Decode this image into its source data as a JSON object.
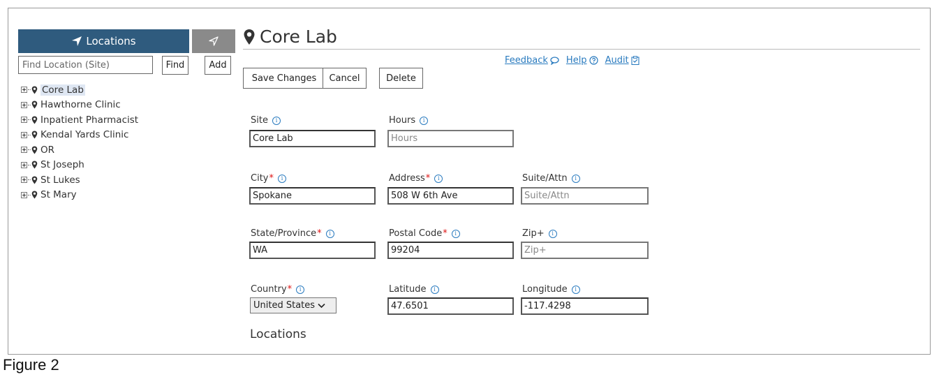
{
  "sidebar": {
    "tab_label": "Locations",
    "search_placeholder": "Find Location (Site)",
    "find_label": "Find",
    "add_label": "Add",
    "items": [
      {
        "label": "Core Lab"
      },
      {
        "label": "Hawthorne Clinic"
      },
      {
        "label": "Inpatient Pharmacist"
      },
      {
        "label": "Kendal Yards Clinic"
      },
      {
        "label": "OR"
      },
      {
        "label": "St Joseph"
      },
      {
        "label": "St Lukes"
      },
      {
        "label": "St Mary"
      }
    ]
  },
  "header": {
    "title": "Core Lab",
    "links": {
      "feedback": "Feedback",
      "help": "Help",
      "audit": "Audit"
    }
  },
  "toolbar": {
    "save_label": "Save Changes",
    "cancel_label": "Cancel",
    "delete_label": "Delete"
  },
  "form": {
    "site": {
      "label": "Site",
      "value": "Core Lab"
    },
    "hours": {
      "label": "Hours",
      "placeholder": "Hours"
    },
    "city": {
      "label": "City",
      "value": "Spokane"
    },
    "address": {
      "label": "Address",
      "value": "508 W 6th Ave"
    },
    "suite": {
      "label": "Suite/Attn",
      "placeholder": "Suite/Attn"
    },
    "state": {
      "label": "State/Province",
      "value": "WA"
    },
    "postal": {
      "label": "Postal Code",
      "value": "99204"
    },
    "zip_plus": {
      "label": "Zip+",
      "placeholder": "Zip+"
    },
    "country": {
      "label": "Country",
      "value": "United States"
    },
    "latitude": {
      "label": "Latitude",
      "value": "47.6501"
    },
    "longitude": {
      "label": "Longitude",
      "value": "-117.4298"
    }
  },
  "required_marker": "*",
  "info_glyph": "i",
  "section_title": "Locations",
  "caption": "Figure 2",
  "colors": {
    "tab_active": "#2f5b7e",
    "tab_inactive": "#8a8a8a",
    "link": "#2a7bbf",
    "required": "#d11"
  }
}
